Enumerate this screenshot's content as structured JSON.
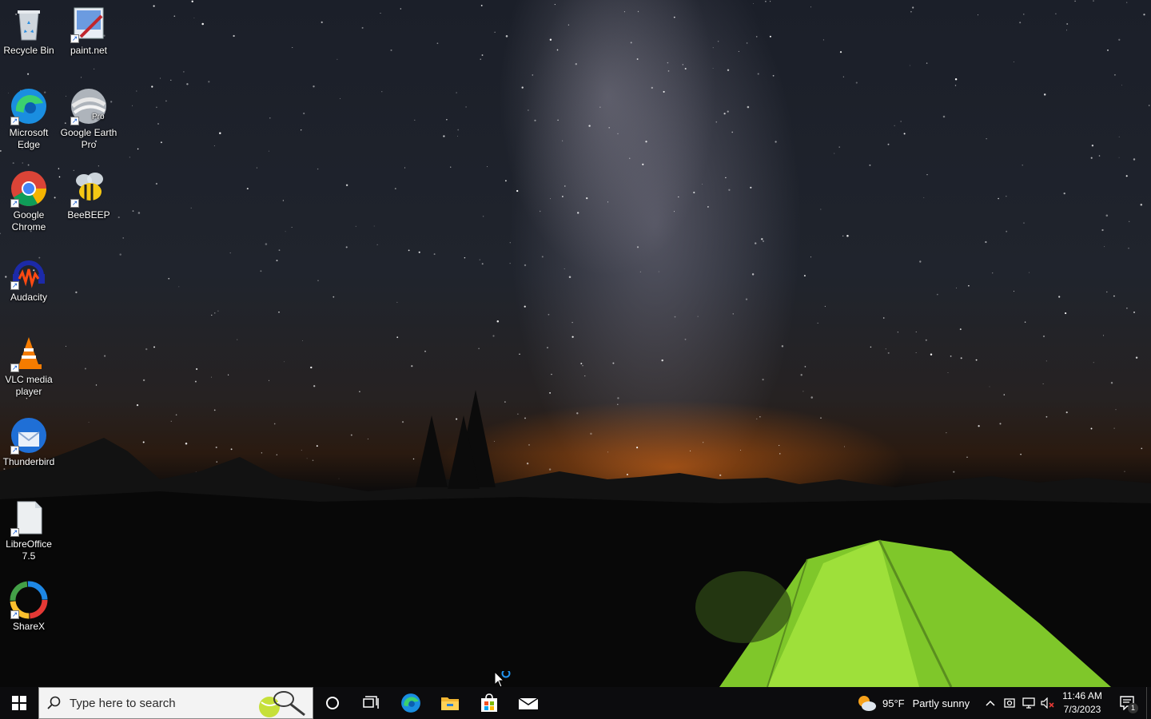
{
  "desktop": {
    "icons": [
      {
        "label": "Recycle Bin",
        "icon": "recycle-bin-icon"
      },
      {
        "label": "paint.net",
        "icon": "paint-net-icon"
      },
      {
        "label": "Microsoft Edge",
        "icon": "edge-icon"
      },
      {
        "label": "Google Earth Pro",
        "icon": "google-earth-icon"
      },
      {
        "label": "Google Chrome",
        "icon": "chrome-icon"
      },
      {
        "label": "BeeBEEP",
        "icon": "beebeep-icon"
      },
      {
        "label": "Audacity",
        "icon": "audacity-icon"
      },
      {
        "label": "VLC media player",
        "icon": "vlc-icon"
      },
      {
        "label": "Thunderbird",
        "icon": "thunderbird-icon"
      },
      {
        "label": "LibreOffice 7.5",
        "icon": "libreoffice-icon"
      },
      {
        "label": "ShareX",
        "icon": "sharex-icon"
      }
    ],
    "earth_badge": "Pro"
  },
  "taskbar": {
    "search_placeholder": "Type here to search",
    "pinned": [
      "cortana-icon",
      "task-view-icon",
      "edge-icon",
      "file-explorer-icon",
      "microsoft-store-icon",
      "mail-icon"
    ],
    "weather": {
      "temp": "95°F",
      "condition": "Partly sunny"
    },
    "clock": {
      "time": "11:46 AM",
      "date": "7/3/2023"
    },
    "notifications_count": "1"
  },
  "colors": {
    "taskbar": "#0c0c0e",
    "accent": "#1e88e5",
    "tent": "#8fd42a"
  }
}
